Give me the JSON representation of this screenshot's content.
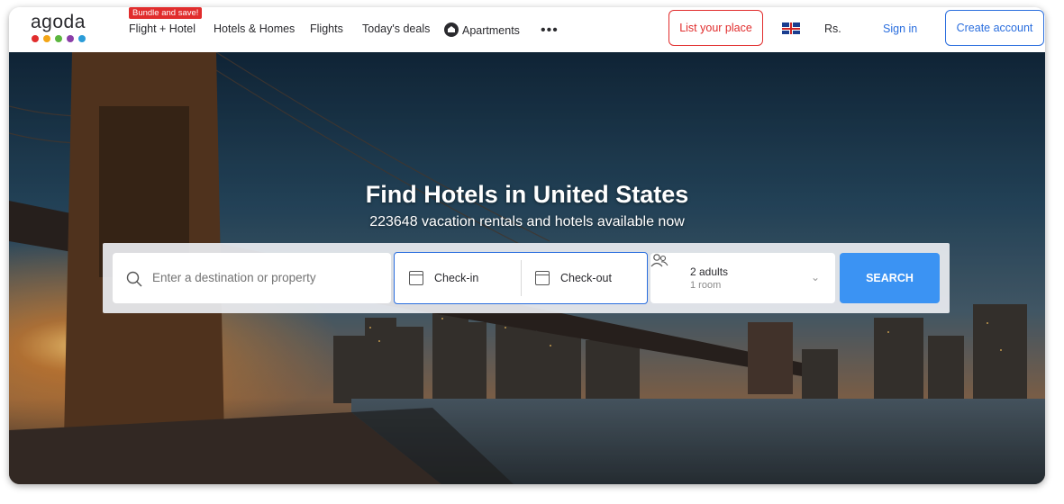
{
  "header": {
    "logo_text": "agoda",
    "logo_dots": [
      "#e12d2d",
      "#f3a516",
      "#5bb63e",
      "#8a3ea8",
      "#2b9cd8"
    ],
    "bundle_badge": "Bundle and save!",
    "nav": [
      {
        "label": "Flight + Hotel"
      },
      {
        "label": "Hotels & Homes"
      },
      {
        "label": "Flights"
      },
      {
        "label": "Today's deals"
      },
      {
        "label": "Apartments",
        "icon": "apartment-icon"
      }
    ],
    "more_icon": "•••",
    "list_your_place": "List your place",
    "currency": "Rs.",
    "sign_in": "Sign in",
    "create_account": "Create account"
  },
  "hero": {
    "title": "Find Hotels in United States",
    "subtitle": "223648 vacation rentals and hotels available now"
  },
  "search": {
    "destination_placeholder": "Enter a destination or property",
    "check_in": "Check-in",
    "check_out": "Check-out",
    "guests": "2 adults",
    "rooms": "1 room",
    "button": "SEARCH"
  },
  "colors": {
    "accent_red": "#e12d2d",
    "accent_blue": "#2a6ede",
    "search_button": "#3b93f3"
  }
}
